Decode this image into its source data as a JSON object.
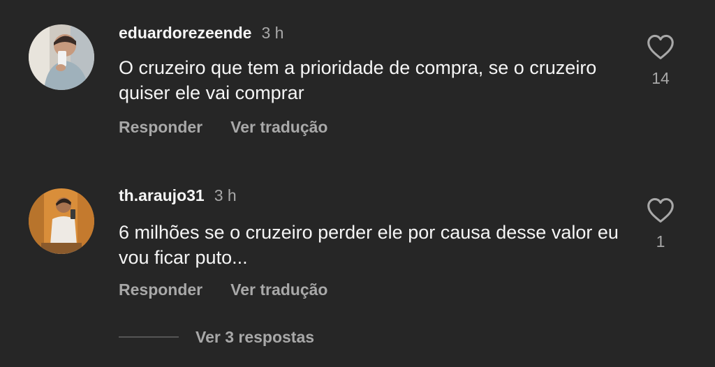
{
  "colors": {
    "background": "#262626",
    "primary_text": "#f5f5f5",
    "secondary_text": "#a8a8a8"
  },
  "comments": [
    {
      "username": "eduardorezeende",
      "time": "3 h",
      "text": "O cruzeiro que tem a prioridade de compra, se o cruzeiro quiser ele vai comprar",
      "likes": "14",
      "reply_label": "Responder",
      "translate_label": "Ver tradução",
      "like_icon": "heart-outline-icon"
    },
    {
      "username": "th.araujo31",
      "time": "3 h",
      "text": "6 milhões se o cruzeiro perder ele por causa desse valor eu vou ficar puto...",
      "likes": "1",
      "reply_label": "Responder",
      "translate_label": "Ver tradução",
      "like_icon": "heart-outline-icon"
    }
  ],
  "view_replies_label": "Ver 3 respostas"
}
